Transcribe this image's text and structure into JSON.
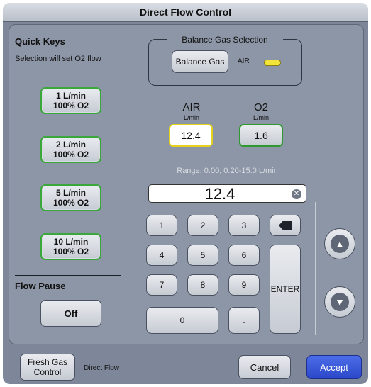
{
  "window": {
    "title": "Direct Flow Control"
  },
  "quick_keys": {
    "heading": "Quick Keys",
    "subtitle": "Selection will set O2 flow",
    "buttons": [
      {
        "line1": "1 L/min",
        "line2": "100% O2"
      },
      {
        "line1": "2 L/min",
        "line2": "100% O2"
      },
      {
        "line1": "5 L/min",
        "line2": "100% O2"
      },
      {
        "line1": "10 L/min",
        "line2": "100% O2"
      }
    ]
  },
  "flow_pause": {
    "heading": "Flow Pause",
    "button_label": "Off"
  },
  "balance_gas": {
    "title": "Balance Gas Selection",
    "button_label": "Balance Gas",
    "current": "AIR",
    "indicator_color": "#f3e43a"
  },
  "air": {
    "label": "AIR",
    "unit": "L/min",
    "value": "12.4",
    "border_color": "#e4d21c"
  },
  "o2": {
    "label": "O2",
    "unit": "L/min",
    "value": "1.6",
    "border_color": "#2e9a2e"
  },
  "range_text": "Range: 0.00, 0.20-15.0 L/min",
  "entry": {
    "value": "12.4"
  },
  "keypad": {
    "keys": [
      "1",
      "2",
      "3",
      "4",
      "5",
      "6",
      "7",
      "8",
      "9",
      "0",
      "."
    ],
    "enter_label": "ENTER"
  },
  "footer": {
    "fresh_gas_line1": "Fresh Gas",
    "fresh_gas_line2": "Control",
    "mode": "Direct Flow",
    "cancel_label": "Cancel",
    "accept_label": "Accept"
  }
}
